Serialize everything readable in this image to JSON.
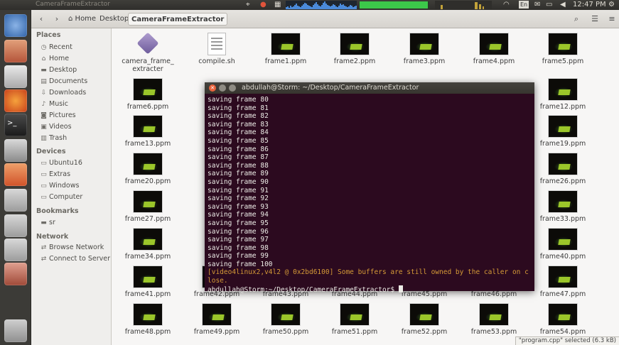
{
  "topbar": {
    "window_title": "CameraFrameExtractor",
    "time": "12:47 PM",
    "keyboard_layout": "En",
    "cpu_history": [
      3,
      4,
      2,
      5,
      3,
      4,
      6,
      8,
      5,
      4,
      3,
      5,
      7,
      9,
      8,
      6,
      5,
      4,
      3,
      6,
      8,
      10,
      7,
      5,
      4,
      6,
      9,
      11,
      8,
      6,
      5,
      4,
      5,
      7,
      6,
      4,
      3,
      5,
      8,
      6,
      7,
      5,
      4,
      3,
      4,
      6,
      5,
      3,
      4,
      5
    ],
    "mem_used_fraction": 0.98
  },
  "launcher": {
    "items": [
      "ubuntu-dash",
      "files",
      "libreoffice",
      "firefox",
      "terminal",
      "camera",
      "software-center",
      "drive",
      "drive",
      "drive",
      "usb",
      "trash"
    ]
  },
  "nautilus": {
    "breadcrumbs": [
      "Home",
      "Desktop",
      "CameraFrameExtractor"
    ],
    "sidebar": {
      "places_header": "Places",
      "places": [
        {
          "icon": "clock-icon",
          "label": "Recent"
        },
        {
          "icon": "home-icon",
          "label": "Home"
        },
        {
          "icon": "folder-icon",
          "label": "Desktop"
        },
        {
          "icon": "document-icon",
          "label": "Documents"
        },
        {
          "icon": "download-icon",
          "label": "Downloads"
        },
        {
          "icon": "music-icon",
          "label": "Music"
        },
        {
          "icon": "camera-icon",
          "label": "Pictures"
        },
        {
          "icon": "film-icon",
          "label": "Videos"
        },
        {
          "icon": "trash-icon",
          "label": "Trash"
        }
      ],
      "devices_header": "Devices",
      "devices": [
        {
          "icon": "drive-icon",
          "label": "Ubuntu16"
        },
        {
          "icon": "drive-icon",
          "label": "Extras"
        },
        {
          "icon": "drive-icon",
          "label": "Windows"
        },
        {
          "icon": "computer-icon",
          "label": "Computer"
        }
      ],
      "bookmarks_header": "Bookmarks",
      "bookmarks": [
        {
          "icon": "folder-icon",
          "label": "sr"
        }
      ],
      "network_header": "Network",
      "network": [
        {
          "icon": "network-icon",
          "label": "Browse Network"
        },
        {
          "icon": "network-icon",
          "label": "Connect to Server"
        }
      ]
    },
    "files": {
      "row0": [
        "camera_frame_ extracter",
        "compile.sh",
        "frame1.ppm",
        "frame2.ppm",
        "frame3.ppm",
        "frame4.ppm",
        "frame5.ppm"
      ],
      "row1": [
        "frame6.ppm",
        "",
        "",
        "",
        "",
        "",
        "frame12.ppm"
      ],
      "row2": [
        "frame13.ppm",
        "",
        "",
        "",
        "",
        "",
        "frame19.ppm"
      ],
      "row3": [
        "frame20.ppm",
        "",
        "",
        "",
        "",
        "",
        "frame26.ppm"
      ],
      "row4": [
        "frame27.ppm",
        "",
        "",
        "",
        "",
        "",
        "frame33.ppm"
      ],
      "row5": [
        "frame34.ppm",
        "",
        "",
        "",
        "",
        "",
        "frame40.ppm"
      ],
      "row6": [
        "frame41.ppm",
        "frame42.ppm",
        "frame43.ppm",
        "frame44.ppm",
        "frame45.ppm",
        "frame46.ppm",
        "frame47.ppm"
      ],
      "row7": [
        "frame48.ppm",
        "frame49.ppm",
        "frame50.ppm",
        "frame51.ppm",
        "frame52.ppm",
        "frame53.ppm",
        "frame54.ppm"
      ]
    },
    "status": "\"program.cpp\" selected (6.3 kB)"
  },
  "terminal": {
    "title": "abdullah@Storm: ~/Desktop/CameraFrameExtractor",
    "lines": [
      "saving frame 80",
      "saving frame 81",
      "saving frame 82",
      "saving frame 83",
      "saving frame 84",
      "saving frame 85",
      "saving frame 86",
      "saving frame 87",
      "saving frame 88",
      "saving frame 89",
      "saving frame 90",
      "saving frame 91",
      "saving frame 92",
      "saving frame 93",
      "saving frame 94",
      "saving frame 95",
      "saving frame 96",
      "saving frame 97",
      "saving frame 98",
      "saving frame 99",
      "saving frame 100"
    ],
    "warning": "[video4linux2,v4l2 @ 0x2bd6100] Some buffers are still owned by the caller on close.",
    "prompt": "abdullah@Storm:~/Desktop/CameraFrameExtractor$ "
  }
}
